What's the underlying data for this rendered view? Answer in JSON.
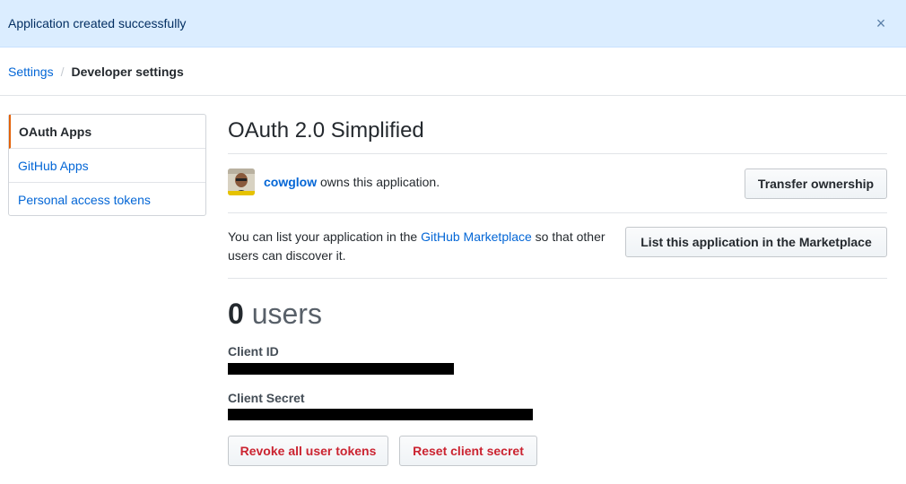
{
  "flash": {
    "message": "Application created successfully",
    "close_glyph": "×"
  },
  "breadcrumb": {
    "root": "Settings",
    "separator": "/",
    "current": "Developer settings"
  },
  "sidebar": {
    "items": [
      {
        "label": "OAuth Apps",
        "selected": true
      },
      {
        "label": "GitHub Apps",
        "selected": false
      },
      {
        "label": "Personal access tokens",
        "selected": false
      }
    ]
  },
  "app": {
    "title": "OAuth 2.0 Simplified",
    "owner_login": "cowglow",
    "owner_suffix": " owns this application.",
    "transfer_button": "Transfer ownership",
    "market_text_before": "You can list your application in the ",
    "market_link": "GitHub Marketplace",
    "market_text_after": " so that other users can discover it.",
    "market_button": "List this application in the Marketplace",
    "users_count": "0",
    "users_label": " users",
    "client_id_label": "Client ID",
    "client_secret_label": "Client Secret",
    "revoke_button": "Revoke all user tokens",
    "reset_button": "Reset client secret"
  },
  "colors": {
    "link": "#0366d6",
    "danger": "#cb2431",
    "flash_bg": "#dbedff",
    "selected_accent": "#e36209"
  }
}
